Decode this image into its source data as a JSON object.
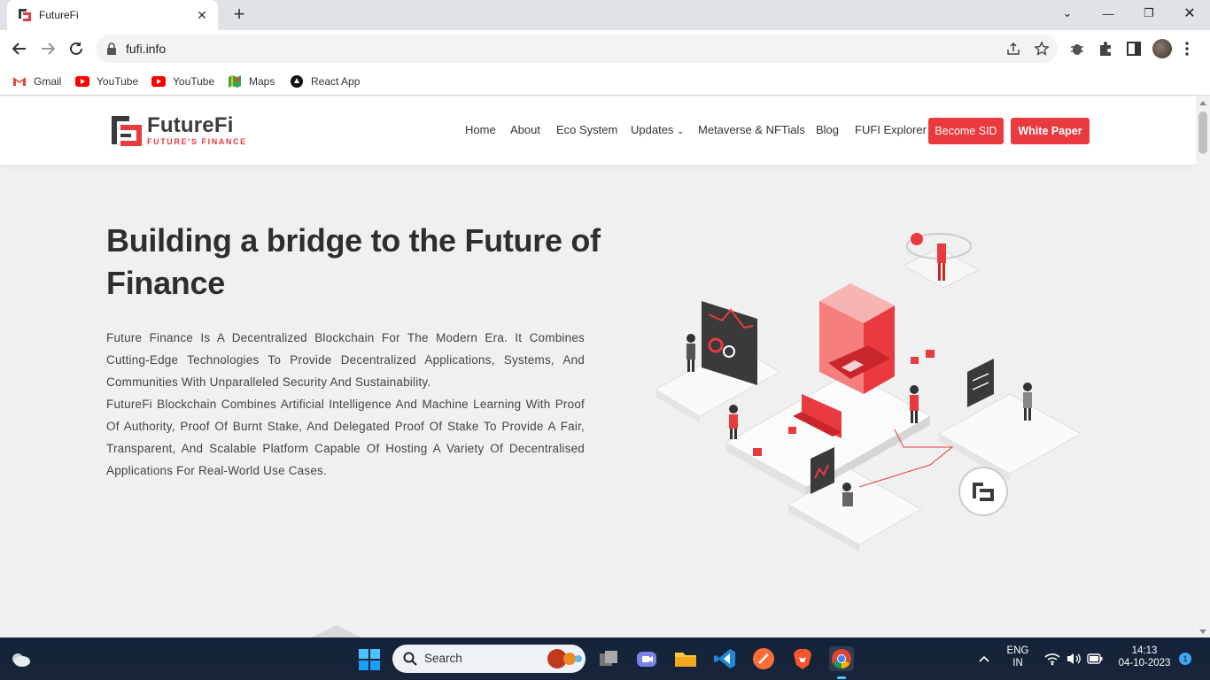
{
  "browser": {
    "tab_title": "FutureFi",
    "url": "fufi.info",
    "bookmarks": [
      {
        "label": "Gmail",
        "icon": "gmail-icon"
      },
      {
        "label": "YouTube",
        "icon": "youtube-icon"
      },
      {
        "label": "YouTube",
        "icon": "youtube-icon"
      },
      {
        "label": "Maps",
        "icon": "maps-icon"
      },
      {
        "label": "React App",
        "icon": "react-app-icon"
      }
    ]
  },
  "site": {
    "logo_name": "FutureFi",
    "logo_tagline": "FUTURE'S FINANCE",
    "nav": [
      "Home",
      "About",
      "Eco System",
      "Updates",
      "Metaverse & NFTials",
      "Blog",
      "FUFI Explorer"
    ],
    "updates_chevron": "⌄",
    "become_sid": "Become SID",
    "white_paper": "White Paper",
    "hero_title": "Building a bridge to the Future of Finance",
    "hero_para1": "Future Finance Is A Decentralized Blockchain For The Modern Era. It Combines Cutting-Edge Technologies To Provide Decentralized Applications, Systems, And Communities With Unparalleled Security And Sustainability.",
    "hero_para2": "FutureFi Blockchain Combines Artificial Intelligence And Machine Learning With Proof Of Authority, Proof Of Burnt Stake, And Delegated Proof Of Stake To Provide A Fair, Transparent, And Scalable Platform Capable Of Hosting A Variety Of Decentralised Applications For Real-World Use Cases."
  },
  "taskbar": {
    "search_label": "Search",
    "lang_line1": "ENG",
    "lang_line2": "IN",
    "time": "14:13",
    "date": "04-10-2023",
    "notification_count": "1"
  },
  "colors": {
    "brand_red": "#e93a3f",
    "text_dark": "#2e2e2e",
    "page_bg": "#f1f0f0"
  }
}
